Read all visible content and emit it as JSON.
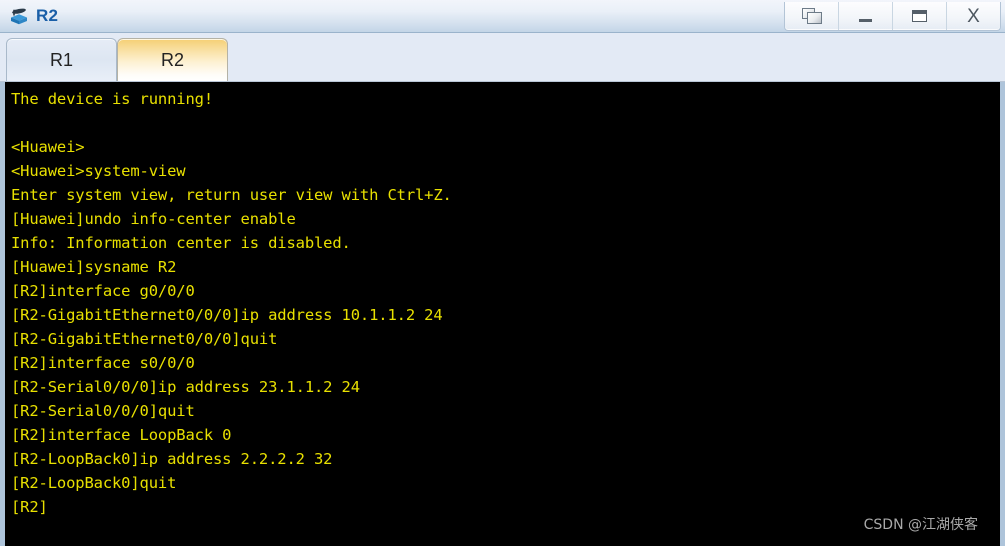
{
  "window": {
    "title": "R2",
    "icon": "router-device-icon",
    "controls": [
      {
        "name": "restore-windows-button",
        "icon": "restore-windows-icon",
        "label": ""
      },
      {
        "name": "minimize-button",
        "icon": "minimize-icon",
        "label": ""
      },
      {
        "name": "maximize-button",
        "icon": "maximize-icon",
        "label": ""
      },
      {
        "name": "close-button",
        "icon": "close-icon",
        "label": "X"
      }
    ]
  },
  "tabs": [
    {
      "label": "R1",
      "active": false
    },
    {
      "label": "R2",
      "active": true
    }
  ],
  "terminal": {
    "foreground_color": "#e8e000",
    "background_color": "#000000",
    "lines": [
      "The device is running!",
      "",
      "<Huawei>",
      "<Huawei>system-view",
      "Enter system view, return user view with Ctrl+Z.",
      "[Huawei]undo info-center enable",
      "Info: Information center is disabled.",
      "[Huawei]sysname R2",
      "[R2]interface g0/0/0",
      "[R2-GigabitEthernet0/0/0]ip address 10.1.1.2 24",
      "[R2-GigabitEthernet0/0/0]quit",
      "[R2]interface s0/0/0",
      "[R2-Serial0/0/0]ip address 23.1.1.2 24",
      "[R2-Serial0/0/0]quit",
      "[R2]interface LoopBack 0",
      "[R2-LoopBack0]ip address 2.2.2.2 32",
      "[R2-LoopBack0]quit",
      "[R2]"
    ]
  },
  "watermark": {
    "text": "CSDN @江湖侠客"
  }
}
